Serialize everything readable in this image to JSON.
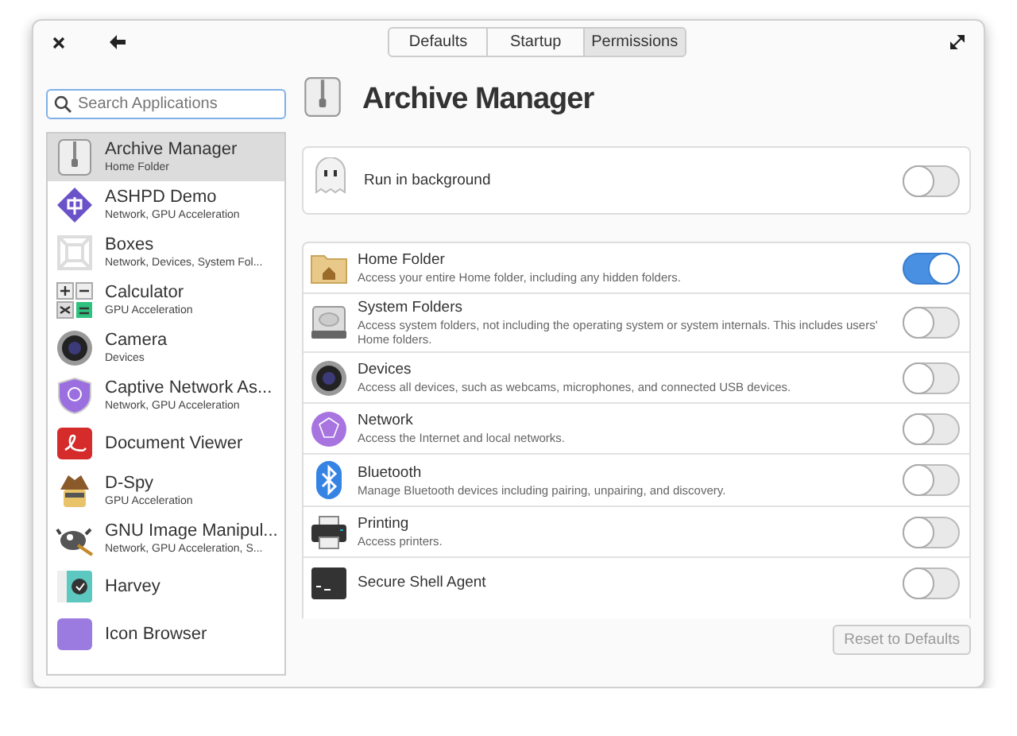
{
  "header": {
    "tabs": [
      {
        "label": "Defaults",
        "selected": false
      },
      {
        "label": "Startup",
        "selected": false
      },
      {
        "label": "Permissions",
        "selected": true
      }
    ]
  },
  "sidebar": {
    "search": {
      "placeholder": "Search Applications"
    },
    "items": [
      {
        "kind": "archive",
        "name": "Archive Manager",
        "detail": "Home Folder",
        "selected": true
      },
      {
        "kind": "ashpd",
        "name": "ASHPD Demo",
        "detail": "Network, GPU Acceleration",
        "selected": false
      },
      {
        "kind": "boxes",
        "name": "Boxes",
        "detail": "Network, Devices, System Fol...",
        "selected": false
      },
      {
        "kind": "calculator",
        "name": "Calculator",
        "detail": "GPU Acceleration",
        "selected": false
      },
      {
        "kind": "camera",
        "name": "Camera",
        "detail": "Devices",
        "selected": false
      },
      {
        "kind": "shield",
        "name": "Captive Network As...",
        "detail": "Network, GPU Acceleration",
        "selected": false
      },
      {
        "kind": "document",
        "name": "Document Viewer",
        "selected": false
      },
      {
        "kind": "spy",
        "name": "D-Spy",
        "detail": "GPU Acceleration",
        "selected": false
      },
      {
        "kind": "gimp",
        "name": "GNU Image Manipul...",
        "detail": "Network, GPU Acceleration, S...",
        "selected": false
      },
      {
        "kind": "harvey",
        "name": "Harvey",
        "selected": false
      },
      {
        "kind": "icons",
        "name": "Icon Browser",
        "selected": false
      }
    ]
  },
  "main": {
    "app": {
      "kind": "archive",
      "title": "Archive Manager"
    },
    "background": {
      "kind": "ghost",
      "label": "Run in background",
      "on": false
    },
    "permissions": [
      {
        "kind": "home",
        "title": "Home Folder",
        "description": "Access your entire Home folder, including any hidden folders.",
        "on": true
      },
      {
        "kind": "disk",
        "title": "System Folders",
        "description": "Access system folders, not including the operating system or system internals. This includes users' Home folders.",
        "on": false
      },
      {
        "kind": "camera",
        "title": "Devices",
        "description": "Access all devices, such as webcams, microphones, and connected USB devices.",
        "on": false
      },
      {
        "kind": "network",
        "title": "Network",
        "description": "Access the Internet and local networks.",
        "on": false
      },
      {
        "kind": "bluetooth",
        "title": "Bluetooth",
        "description": "Manage Bluetooth devices including pairing, unpairing, and discovery.",
        "on": false
      },
      {
        "kind": "printer",
        "title": "Printing",
        "description": "Access printers.",
        "on": false
      },
      {
        "kind": "terminal",
        "title": "Secure Shell Agent",
        "on": false
      }
    ],
    "reset_button": {
      "label": "Reset to Defaults",
      "disabled": true
    }
  }
}
